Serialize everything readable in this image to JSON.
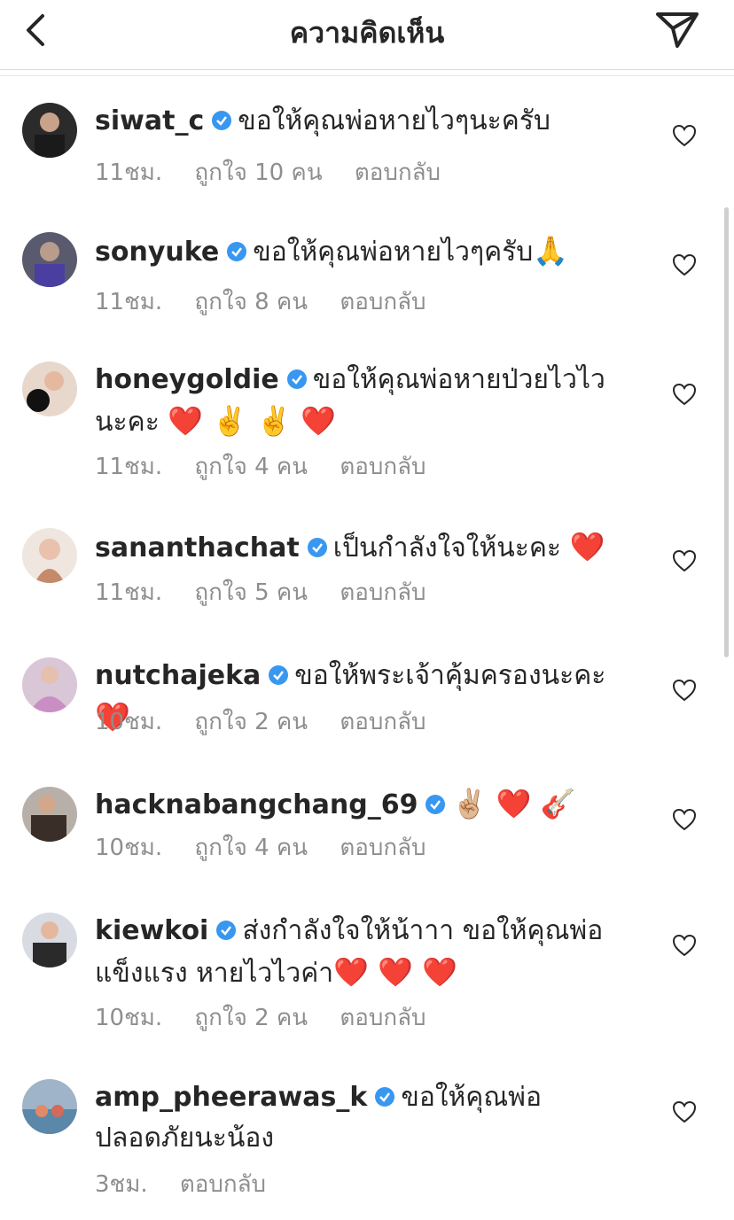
{
  "header": {
    "title": "ความคิดเห็น"
  },
  "comments": [
    {
      "username": "siwat_c",
      "text": "ขอให้คุณพ่อหายไวๆนะครับ",
      "emojis": "",
      "time": "11ชม.",
      "likes": "ถูกใจ 10 คน",
      "reply": "ตอบกลับ"
    },
    {
      "username": "sonyuke",
      "text": "ขอให้คุณพ่อหายไวๆครับ",
      "emojis": "🙏",
      "time": "11ชม.",
      "likes": "ถูกใจ 8 คน",
      "reply": "ตอบกลับ"
    },
    {
      "username": "honeygoldie",
      "text": "ขอให้คุณพ่อหายป่วยไวไวนะคะ",
      "emojis": "❤️ ✌️ ✌️ ❤️",
      "time": "11ชม.",
      "likes": "ถูกใจ 4 คน",
      "reply": "ตอบกลับ"
    },
    {
      "username": "sananthachat",
      "text": "เป็นกำลังใจให้นะคะ",
      "emojis": "❤️",
      "time": "11ชม.",
      "likes": "ถูกใจ 5 คน",
      "reply": "ตอบกลับ"
    },
    {
      "username": "nutchajeka",
      "text": "ขอให้พระเจ้าคุ้มครองนะคะ",
      "emojis": "❤️",
      "time": "10ชม.",
      "likes": "ถูกใจ 2 คน",
      "reply": "ตอบกลับ"
    },
    {
      "username": "hacknabangchang_69",
      "text": "",
      "emojis": "✌🏼 ❤️ 🎸",
      "time": "10ชม.",
      "likes": "ถูกใจ 4 คน",
      "reply": "ตอบกลับ"
    },
    {
      "username": "kiewkoi",
      "text": "ส่งกำลังใจให้น้าาา ขอให้คุณพ่อแข็งแรง หายไวไวค่า",
      "emojis": "❤️ ❤️ ❤️",
      "time": "10ชม.",
      "likes": "ถูกใจ 2 คน",
      "reply": "ตอบกลับ"
    },
    {
      "username": "amp_pheerawas_k",
      "text": "ขอให้คุณพ่อปลอดภัยนะน้อง",
      "emojis": "",
      "time": "3ชม.",
      "likes": "",
      "reply": "ตอบกลับ"
    }
  ],
  "colors": {
    "verified": "#3897f0",
    "meta": "#8e8e8e",
    "text": "#262626"
  }
}
